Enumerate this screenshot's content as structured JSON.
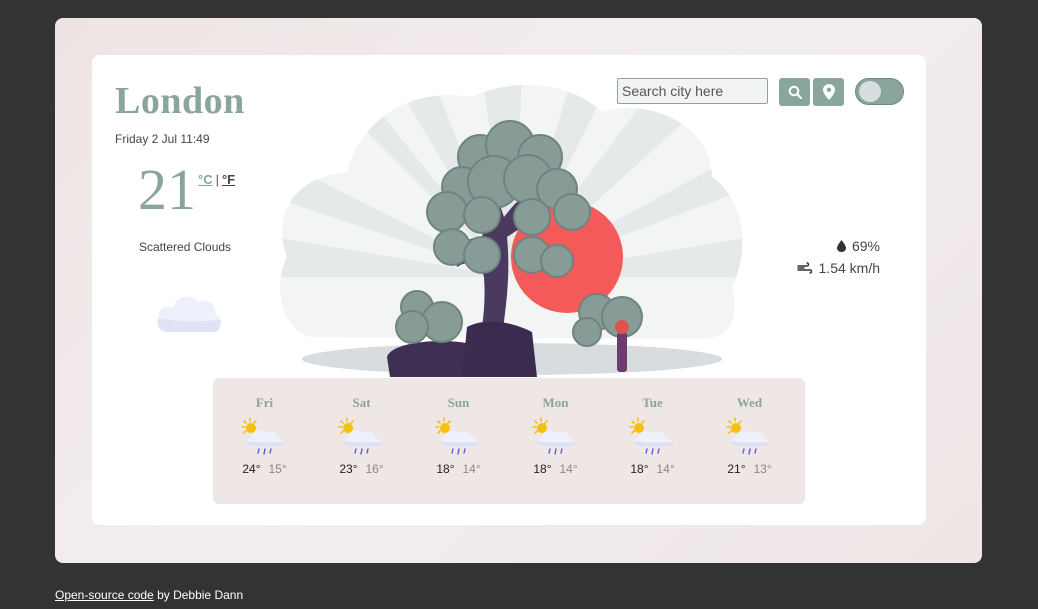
{
  "city": "London",
  "date": "Friday 2 Jul 11:49",
  "temperature": "21",
  "units": {
    "celsius": "°C",
    "separator": "|",
    "fahrenheit": "°F"
  },
  "description": "Scattered Clouds",
  "humidity": "69%",
  "wind": "1.54 km/h",
  "search": {
    "placeholder": "Search city here"
  },
  "forecast": [
    {
      "day": "Fri",
      "max": "24°",
      "min": "15°",
      "icon": "sun-rain-icon"
    },
    {
      "day": "Sat",
      "max": "23°",
      "min": "16°",
      "icon": "sun-rain-icon"
    },
    {
      "day": "Sun",
      "max": "18°",
      "min": "14°",
      "icon": "sun-rain-icon"
    },
    {
      "day": "Mon",
      "max": "18°",
      "min": "14°",
      "icon": "sun-rain-icon"
    },
    {
      "day": "Tue",
      "max": "18°",
      "min": "14°",
      "icon": "sun-rain-icon"
    },
    {
      "day": "Wed",
      "max": "21°",
      "min": "13°",
      "icon": "sun-rain-icon"
    }
  ],
  "footer": {
    "link": "Open-source code",
    "text": " by Debbie Dann"
  },
  "colors": {
    "accent": "#8aa49e",
    "background": "#333333",
    "sun": "#f45a5a",
    "forecast_bg": "#efe6e6"
  }
}
